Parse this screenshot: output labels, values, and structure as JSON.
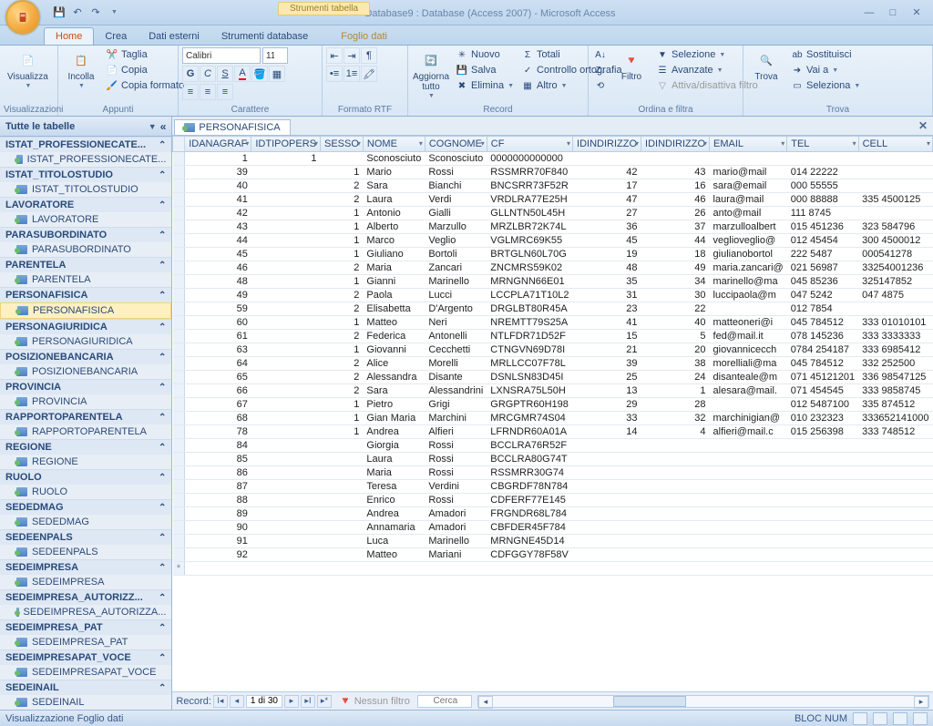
{
  "title": {
    "context": "Strumenti tabella",
    "dbname": "Database9 : Database (Access 2007) - Microsoft Access"
  },
  "tabs": {
    "home": "Home",
    "crea": "Crea",
    "datiest": "Dati esterni",
    "strdb": "Strumenti database",
    "foglio": "Foglio dati"
  },
  "ribbon": {
    "visualizza": "Visualizza",
    "visualizzazioni": "Visualizzazioni",
    "incolla": "Incolla",
    "taglia": "Taglia",
    "copia": "Copia",
    "copiaformato": "Copia formato",
    "appunti": "Appunti",
    "font": "Calibri",
    "size": "11",
    "carattere": "Carattere",
    "formatortf": "Formato RTF",
    "aggiorna": "Aggiorna tutto",
    "nuovo": "Nuovo",
    "salva": "Salva",
    "elimina": "Elimina",
    "totali": "Totali",
    "ortografia": "Controllo ortografia",
    "altro": "Altro",
    "record": "Record",
    "filtro": "Filtro",
    "selezione": "Selezione",
    "avanzate": "Avanzate",
    "adfiltro": "Attiva/disattiva filtro",
    "ordinaefiltra": "Ordina e filtra",
    "trova": "Trova",
    "sostituisci": "Sostituisci",
    "vaia": "Vai a",
    "seleziona": "Seleziona",
    "trova_g": "Trova"
  },
  "nav": {
    "head": "Tutte le tabelle",
    "groups": [
      {
        "name": "ISTAT_PROFESSIONECATE...",
        "items": [
          "ISTAT_PROFESSIONECATE..."
        ]
      },
      {
        "name": "ISTAT_TITOLOSTUDIO",
        "items": [
          "ISTAT_TITOLOSTUDIO"
        ]
      },
      {
        "name": "LAVORATORE",
        "items": [
          "LAVORATORE"
        ]
      },
      {
        "name": "PARASUBORDINATO",
        "items": [
          "PARASUBORDINATO"
        ]
      },
      {
        "name": "PARENTELA",
        "items": [
          "PARENTELA"
        ]
      },
      {
        "name": "PERSONAFISICA",
        "items": [
          "PERSONAFISICA"
        ],
        "selected": true
      },
      {
        "name": "PERSONAGIURIDICA",
        "items": [
          "PERSONAGIURIDICA"
        ]
      },
      {
        "name": "POSIZIONEBANCARIA",
        "items": [
          "POSIZIONEBANCARIA"
        ]
      },
      {
        "name": "PROVINCIA",
        "items": [
          "PROVINCIA"
        ]
      },
      {
        "name": "RAPPORTOPARENTELA",
        "items": [
          "RAPPORTOPARENTELA"
        ]
      },
      {
        "name": "REGIONE",
        "items": [
          "REGIONE"
        ]
      },
      {
        "name": "RUOLO",
        "items": [
          "RUOLO"
        ]
      },
      {
        "name": "SEDEDMAG",
        "items": [
          "SEDEDMAG"
        ]
      },
      {
        "name": "SEDEENPALS",
        "items": [
          "SEDEENPALS"
        ]
      },
      {
        "name": "SEDEIMPRESA",
        "items": [
          "SEDEIMPRESA"
        ]
      },
      {
        "name": "SEDEIMPRESA_AUTORIZZ...",
        "items": [
          "SEDEIMPRESA_AUTORIZZA..."
        ]
      },
      {
        "name": "SEDEIMPRESA_PAT",
        "items": [
          "SEDEIMPRESA_PAT"
        ]
      },
      {
        "name": "SEDEIMPRESAPAT_VOCE",
        "items": [
          "SEDEIMPRESAPAT_VOCE"
        ]
      },
      {
        "name": "SEDEINAIL",
        "items": [
          "SEDEINAIL"
        ]
      }
    ]
  },
  "sheet": {
    "tabname": "PERSONAFISICA",
    "columns": [
      "IDANAGRAF",
      "IDTIPOPERS",
      "SESSO",
      "NOME",
      "COGNOME",
      "CF",
      "IDINDIRIZZO",
      "IDINDIRIZZO",
      "EMAIL",
      "TEL",
      "CELL"
    ],
    "rows": [
      [
        "1",
        "1",
        "",
        "Sconosciuto",
        "Sconosciuto",
        "0000000000000",
        "",
        "",
        "",
        "",
        ""
      ],
      [
        "39",
        "",
        "1",
        "Mario",
        "Rossi",
        "RSSMRR70F840",
        "42",
        "43",
        "mario@mail",
        "014 22222",
        ""
      ],
      [
        "40",
        "",
        "2",
        "Sara",
        "Bianchi",
        "BNCSRR73F52R",
        "17",
        "16",
        "sara@email",
        "000 55555",
        ""
      ],
      [
        "41",
        "",
        "2",
        "Laura",
        "Verdi",
        "VRDLRA77E25H",
        "47",
        "46",
        "laura@mail",
        "000 88888",
        "335 4500125"
      ],
      [
        "42",
        "",
        "1",
        "Antonio",
        "Gialli",
        "GLLNTN50L45H",
        "27",
        "26",
        "anto@mail",
        "111 8745",
        ""
      ],
      [
        "43",
        "",
        "1",
        "Alberto",
        "Marzullo",
        "MRZLBR72K74L",
        "36",
        "37",
        "marzulloalbert",
        "015 451236",
        "323 584796"
      ],
      [
        "44",
        "",
        "1",
        "Marco",
        "Veglio",
        "VGLMRC69K55",
        "45",
        "44",
        "veglioveglio@",
        "012 45454",
        "300 4500012"
      ],
      [
        "45",
        "",
        "1",
        "Giuliano",
        "Bortoli",
        "BRTGLN60L70G",
        "19",
        "18",
        "giulianobortol",
        "222 5487",
        "000541278"
      ],
      [
        "46",
        "",
        "2",
        "Maria",
        "Zancari",
        "ZNCMRS59K02",
        "48",
        "49",
        "maria.zancari@",
        "021 56987",
        "33254001236"
      ],
      [
        "48",
        "",
        "1",
        "Gianni",
        "Marinello",
        "MRNGNN66E01",
        "35",
        "34",
        "marinello@ma",
        "045 85236",
        "325147852"
      ],
      [
        "49",
        "",
        "2",
        "Paola",
        "Lucci",
        "LCCPLA71T10L2",
        "31",
        "30",
        "luccipaola@m",
        "047 5242",
        "047 4875"
      ],
      [
        "59",
        "",
        "2",
        "Elisabetta",
        "D'Argento",
        "DRGLBT80R45A",
        "23",
        "22",
        "",
        "012 7854",
        ""
      ],
      [
        "60",
        "",
        "1",
        "Matteo",
        "Neri",
        "NREMTT79S25A",
        "41",
        "40",
        "matteoneri@i",
        "045 784512",
        "333 01010101"
      ],
      [
        "61",
        "",
        "2",
        "Federica",
        "Antonelli",
        "NTLFDR71D52F",
        "15",
        "5",
        "fed@mail.it",
        "078 145236",
        "333 3333333"
      ],
      [
        "63",
        "",
        "1",
        "Giovanni",
        "Cecchetti",
        "CTNGVN69D78I",
        "21",
        "20",
        "giovannicecch",
        "0784 254187",
        "333 6985412"
      ],
      [
        "64",
        "",
        "2",
        "Alice",
        "Morelli",
        "MRLLCC07F78L",
        "39",
        "38",
        "morelliali@ma",
        "045 784512",
        "332 252500"
      ],
      [
        "65",
        "",
        "2",
        "Alessandra",
        "Disante",
        "DSNLSN83D45I",
        "25",
        "24",
        "disanteale@m",
        "071 45121201",
        "336 98547125"
      ],
      [
        "66",
        "",
        "2",
        "Sara",
        "Alessandrini",
        "LXNSRA75L50H",
        "13",
        "1",
        "alesara@mail.",
        "071 454545",
        "333 9858745"
      ],
      [
        "67",
        "",
        "1",
        "Pietro",
        "Grigi",
        "GRGPTR60H198",
        "29",
        "28",
        "",
        "012 5487100",
        "335 874512"
      ],
      [
        "68",
        "",
        "1",
        "Gian Maria",
        "Marchini",
        "MRCGMR74S04",
        "33",
        "32",
        "marchinigian@",
        "010 232323",
        "333652141000"
      ],
      [
        "78",
        "",
        "1",
        "Andrea",
        "Alfieri",
        "LFRNDR60A01A",
        "14",
        "4",
        "alfieri@mail.c",
        "015 256398",
        "333 748512"
      ],
      [
        "84",
        "",
        "",
        "Giorgia",
        "Rossi",
        "BCCLRA76R52F",
        "",
        "",
        "",
        "",
        ""
      ],
      [
        "85",
        "",
        "",
        "Laura",
        "Rossi",
        "BCCLRA80G74T",
        "",
        "",
        "",
        "",
        ""
      ],
      [
        "86",
        "",
        "",
        "Maria",
        "Rossi",
        "RSSMRR30G74",
        "",
        "",
        "",
        "",
        ""
      ],
      [
        "87",
        "",
        "",
        "Teresa",
        "Verdini",
        "CBGRDF78N784",
        "",
        "",
        "",
        "",
        ""
      ],
      [
        "88",
        "",
        "",
        "Enrico",
        "Rossi",
        "CDFERF77E145",
        "",
        "",
        "",
        "",
        ""
      ],
      [
        "89",
        "",
        "",
        "Andrea",
        "Amadori",
        "FRGNDR68L784",
        "",
        "",
        "",
        "",
        ""
      ],
      [
        "90",
        "",
        "",
        "Annamaria",
        "Amadori",
        "CBFDER45F784",
        "",
        "",
        "",
        "",
        ""
      ],
      [
        "91",
        "",
        "",
        "Luca",
        "Marinello",
        "MRNGNE45D14",
        "",
        "",
        "",
        "",
        ""
      ],
      [
        "92",
        "",
        "",
        "Matteo",
        "Mariani",
        "CDFGGY78F58V",
        "",
        "",
        "",
        "",
        ""
      ]
    ],
    "recnav": {
      "label": "Record:",
      "pos": "1 di 30",
      "filter": "Nessun filtro",
      "search": "Cerca"
    }
  },
  "status": {
    "left": "Visualizzazione Foglio dati",
    "blocnum": "BLOC NUM"
  }
}
